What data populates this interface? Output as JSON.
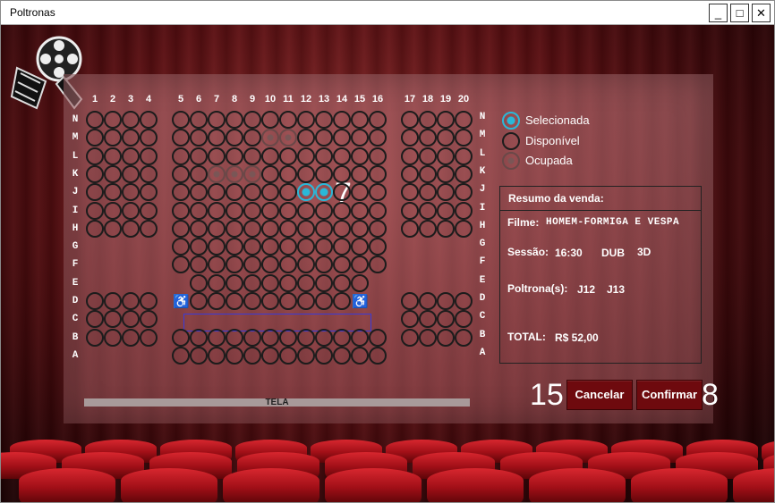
{
  "window": {
    "title": "Poltronas",
    "minimize": "_",
    "maximize": "□",
    "close": "✕"
  },
  "logo": {
    "icon": "film-reel-icon"
  },
  "columns": [
    "1",
    "2",
    "3",
    "4",
    "5",
    "6",
    "7",
    "8",
    "9",
    "10",
    "11",
    "12",
    "13",
    "14",
    "15",
    "16",
    "17",
    "18",
    "19",
    "20"
  ],
  "rows_left": [
    "N",
    "M",
    "L",
    "K",
    "J",
    "I",
    "H",
    "G",
    "F",
    "E",
    "D",
    "C",
    "B",
    "A"
  ],
  "rows_right": [
    "N",
    "M",
    "L",
    "K",
    "J",
    "I",
    "H",
    "G",
    "F",
    "E",
    "D",
    "C",
    "B",
    "A"
  ],
  "seats": {
    "occupied": [
      "M10",
      "M11",
      "K7",
      "K8",
      "K9"
    ],
    "selected": [
      "J12",
      "J13"
    ],
    "wheelchair": [
      "D5",
      "D15"
    ]
  },
  "annotations": {
    "selected_count": "7",
    "cancel_num": "15",
    "confirm_num": "8"
  },
  "legend": {
    "selected": "Selecionada",
    "available": "Disponível",
    "occupied": "Ocupada"
  },
  "summary": {
    "title": "Resumo da venda:",
    "film_label": "Filme:",
    "film": "HOMEM-FORMIGA E VESPA",
    "session_label": "Sessão:",
    "time": "16:30",
    "audio": "DUB",
    "format": "3D",
    "seats_label": "Poltrona(s):",
    "seat1": "J12",
    "seat2": "J13",
    "total_label": "TOTAL:",
    "total": "R$ 52,00"
  },
  "buttons": {
    "cancel": "Cancelar",
    "confirm": "Confirmar"
  },
  "screen_label": "TELA",
  "colors": {
    "selected": "#2ab8d8",
    "button": "#6e0a0e",
    "occupied": "#6a4848"
  }
}
